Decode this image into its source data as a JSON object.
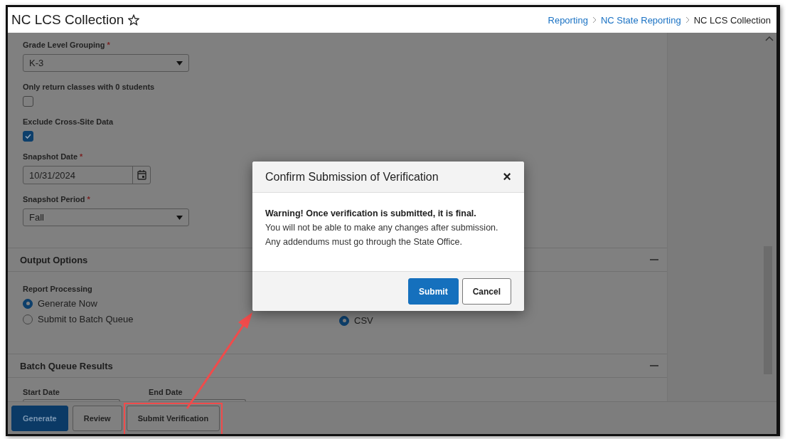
{
  "header": {
    "title": "NC LCS Collection",
    "breadcrumb": [
      {
        "label": "Reporting",
        "current": false
      },
      {
        "label": "NC State Reporting",
        "current": false
      },
      {
        "label": "NC LCS Collection",
        "current": true
      }
    ]
  },
  "fields": [
    {
      "kind": "select",
      "label": "Grade Level Grouping",
      "required_mark": "*",
      "value": "K-3"
    },
    {
      "kind": "checkbox",
      "label": "Only return classes with 0 students",
      "checked": false
    },
    {
      "kind": "checkbox",
      "label": "Exclude Cross-Site Data",
      "checked": true
    },
    {
      "kind": "date",
      "label": "Snapshot Date",
      "required_mark": "*",
      "value": "10/31/2024"
    },
    {
      "kind": "select",
      "label": "Snapshot Period",
      "required_mark": "*",
      "value": "Fall"
    }
  ],
  "output_options": {
    "title": "Output Options",
    "report_processing": {
      "label": "Report Processing",
      "options": [
        {
          "label": "Generate Now",
          "selected": true
        },
        {
          "label": "Submit to Batch Queue",
          "selected": false
        }
      ]
    },
    "format_options": [
      {
        "label": "CSV",
        "selected": true
      }
    ]
  },
  "batch_queue": {
    "title": "Batch Queue Results",
    "fields": [
      {
        "label": "Start Date"
      },
      {
        "label": "End Date"
      }
    ]
  },
  "footer_buttons": [
    {
      "label": "Generate",
      "kind": "primary",
      "highlighted": false
    },
    {
      "label": "Review",
      "kind": "secondary",
      "highlighted": false
    },
    {
      "label": "Submit Verification",
      "kind": "secondary",
      "highlighted": true
    }
  ],
  "dialog": {
    "title": "Confirm Submission of Verification",
    "close": "×",
    "warning": "Warning! Once verification is submitted, it is final.",
    "lines": [
      "You will not be able to make any changes after submission.",
      "Any addendums must go through the State Office."
    ],
    "buttons": [
      {
        "label": "Submit",
        "kind": "primary"
      },
      {
        "label": "Cancel",
        "kind": "secondary"
      }
    ]
  }
}
